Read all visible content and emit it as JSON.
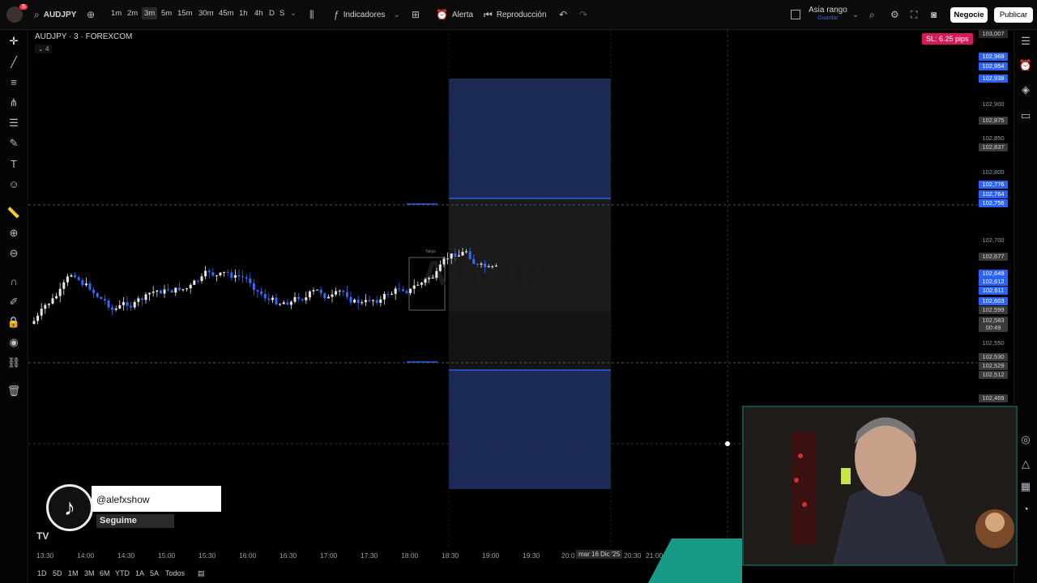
{
  "topbar": {
    "symbol": "AUDJPY",
    "notifications": "5",
    "timeframes": [
      "1m",
      "2m",
      "3m",
      "5m",
      "15m",
      "30m",
      "1h",
      "4h",
      "D",
      "S"
    ],
    "active_timeframe": "3m",
    "indicators_label": "Indicadores",
    "alert_label": "Alerta",
    "replay_label": "Reproducción",
    "layout_name": "Asia rango",
    "layout_status": "Guardar",
    "trade_button": "Negocie",
    "publish_button": "Publicar"
  },
  "chart": {
    "title": "AUDJPY · 3 · FOREXCOM",
    "collapse_count": "4",
    "sl_label": "SL: 6.25 pips",
    "watermark": "AUDJPY, 3",
    "box_label": "Tokyo",
    "price_labels": [
      {
        "text": "103,007",
        "style": "darkgrey"
      },
      {
        "text": "102,969",
        "style": "blue"
      },
      {
        "text": "102,954",
        "style": "blue"
      },
      {
        "text": "102,938",
        "style": "blue"
      },
      {
        "text": "102,900",
        "style": "plain"
      },
      {
        "text": "102,875",
        "style": "grey"
      },
      {
        "text": "102,850",
        "style": "plain"
      },
      {
        "text": "102,837",
        "style": "grey"
      },
      {
        "text": "102,800",
        "style": "plain"
      },
      {
        "text": "102,776",
        "style": "blue"
      },
      {
        "text": "102,764",
        "style": "blue"
      },
      {
        "text": "102,756",
        "style": "blue"
      },
      {
        "text": "102,700",
        "style": "plain"
      },
      {
        "text": "102,677",
        "style": "grey"
      },
      {
        "text": "102,649",
        "style": "blue"
      },
      {
        "text": "102,612",
        "style": "blue"
      },
      {
        "text": "102,611",
        "style": "blue"
      },
      {
        "text": "102,603",
        "style": "blue"
      },
      {
        "text": "102,599",
        "style": "grey"
      },
      {
        "text": "102,583",
        "style": "grey"
      },
      {
        "text": "00:49",
        "style": "grey"
      },
      {
        "text": "102,550",
        "style": "plain"
      },
      {
        "text": "102,530",
        "style": "grey"
      },
      {
        "text": "102,529",
        "style": "grey"
      },
      {
        "text": "102,512",
        "style": "grey"
      },
      {
        "text": "102,469",
        "style": "grey"
      }
    ],
    "time_labels": [
      "13:30",
      "14:00",
      "14:30",
      "15:00",
      "15:30",
      "16:00",
      "16:30",
      "17:00",
      "17:30",
      "18:00",
      "18:30",
      "19:00",
      "19:30",
      "20:0",
      "20:30",
      "21:00"
    ],
    "date_tag": "mar 16 Dic '25"
  },
  "range_bar": {
    "items": [
      "1D",
      "5D",
      "1M",
      "3M",
      "6M",
      "YTD",
      "1A",
      "5A",
      "Todos"
    ]
  },
  "overlay": {
    "tiktok_handle": "@alefxshow",
    "follow_label": "Seguime"
  }
}
